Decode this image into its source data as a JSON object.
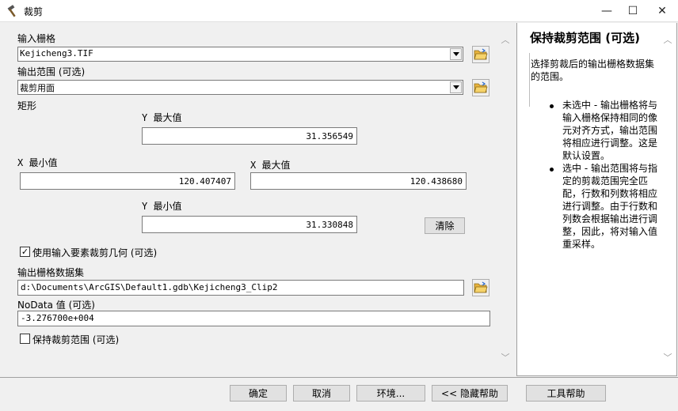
{
  "window": {
    "title": "裁剪",
    "minimize": "—",
    "maximize": "☐",
    "close": "✕"
  },
  "form": {
    "input_raster_label": "输入栅格",
    "input_raster_value": "Kejicheng3.TIF",
    "output_extent_label": "输出范围 (可选)",
    "output_extent_value": "裁剪用面",
    "rectangle_label": "矩形",
    "y_max_label": "Y 最大值",
    "y_max_value": "31.356549",
    "x_min_label": "X 最小值",
    "x_min_value": "120.407407",
    "x_max_label": "X 最大值",
    "x_max_value": "120.438680",
    "y_min_label": "Y 最小值",
    "y_min_value": "31.330848",
    "clear_label": "清除",
    "use_features_label": "使用输入要素裁剪几何 (可选)",
    "use_features_checked": true,
    "output_dataset_label": "输出栅格数据集",
    "output_dataset_value": "d:\\Documents\\ArcGIS\\Default1.gdb\\Kejicheng3_Clip2",
    "nodata_label": "NoData 值 (可选)",
    "nodata_value": "-3.276700e+004",
    "maintain_extent_label": "保持裁剪范围 (可选)",
    "maintain_extent_checked": false
  },
  "help": {
    "title": "保持裁剪范围 (可选)",
    "intro": "选择剪裁后的输出栅格数据集的范围。",
    "bullets": [
      "未选中 - 输出栅格将与输入栅格保持相同的像元对齐方式，输出范围将相应进行调整。这是默认设置。",
      "选中 - 输出范围将与指定的剪裁范围完全匹配，行数和列数将相应进行调整。由于行数和列数会根据输出进行调整，因此，将对输入值重采样。"
    ]
  },
  "buttons": {
    "ok": "确定",
    "cancel": "取消",
    "environments": "环境...",
    "hide_help": "<< 隐藏帮助",
    "tool_help": "工具帮助"
  },
  "icons": {
    "title_icon": "hammer-icon",
    "folder": "open-folder-icon",
    "check": "✓",
    "scroll_up": "︿",
    "scroll_down": "﹀"
  },
  "colors": {
    "window_bg": "#f0f0f0",
    "folder_yellow": "#e8b33c"
  }
}
